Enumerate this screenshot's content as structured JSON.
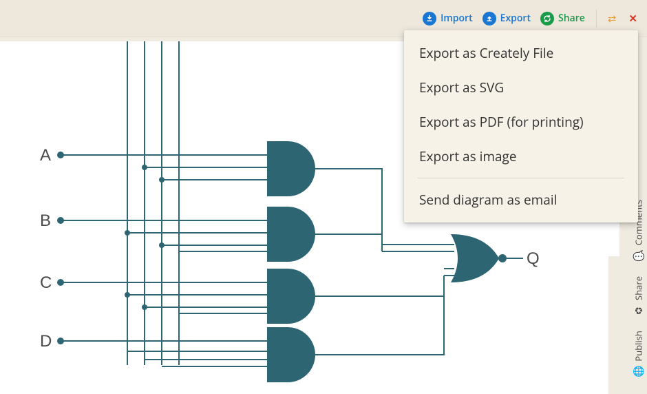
{
  "toolbar": {
    "import_label": "Import",
    "export_label": "Export",
    "share_label": "Share"
  },
  "export_menu": {
    "items": [
      "Export as Creately File",
      "Export as SVG",
      "Export as PDF (for printing)",
      "Export as image"
    ],
    "send_email": "Send diagram as email"
  },
  "side_tabs": {
    "comments": "Comments",
    "share": "Share",
    "publish": "Publish"
  },
  "diagram": {
    "inputs": [
      "A",
      "B",
      "C",
      "D"
    ],
    "output": "Q",
    "gate_color": "#2d6572",
    "wire_color": "#2d6572",
    "type": "logic-circuit",
    "description": "Four AND gates (one per input A-D combined with vertical bus lines) feeding into a single OR/NOR-style gate producing output Q"
  }
}
